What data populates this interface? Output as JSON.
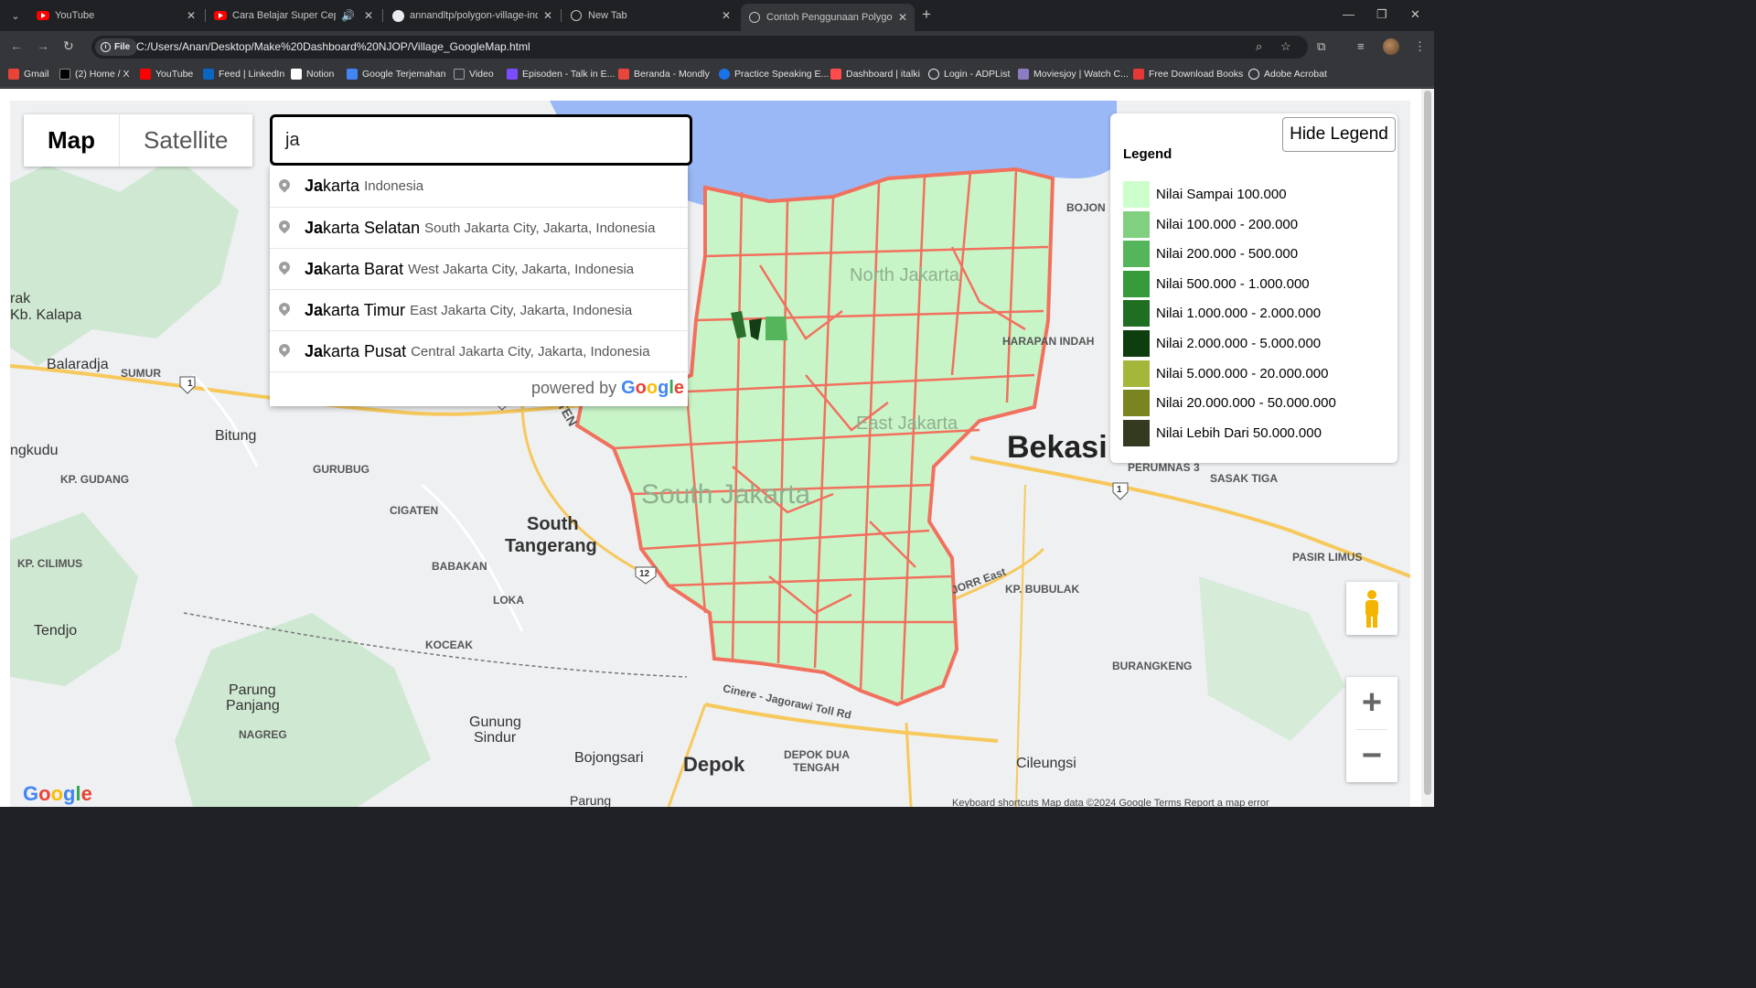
{
  "tabs": [
    {
      "title": "YouTube",
      "icon": "youtube-icon"
    },
    {
      "title": "Cara Belajar Super Cepat pa",
      "icon": "youtube-icon"
    },
    {
      "title": "annandltp/polygon-village-ind",
      "icon": "github-icon"
    },
    {
      "title": "New Tab",
      "icon": "chrome-icon"
    },
    {
      "title": "Contoh Penggunaan Polygon d",
      "icon": "globe-icon"
    }
  ],
  "address": {
    "chip": "File",
    "url": "C:/Users/Anan/Desktop/Make%20Dashboard%20NJOP/Village_GoogleMap.html"
  },
  "bookmarks": [
    {
      "label": "Gmail",
      "color": "#ea4335"
    },
    {
      "label": "(2) Home / X",
      "color": "#000000"
    },
    {
      "label": "YouTube",
      "color": "#ff0000"
    },
    {
      "label": "Feed | LinkedIn",
      "color": "#0a66c2"
    },
    {
      "label": "Notion",
      "color": "#ffffff"
    },
    {
      "label": "Google Terjemahan",
      "color": "#4285f4"
    },
    {
      "label": "Video",
      "color": "#9aa0a6"
    },
    {
      "label": "Episoden - Talk in E...",
      "color": "#7c4dff"
    },
    {
      "label": "Beranda - Mondly",
      "color": "#e8453c"
    },
    {
      "label": "Practice Speaking E...",
      "color": "#1a73e8"
    },
    {
      "label": "Dashboard | italki",
      "color": "#ff4b4b"
    },
    {
      "label": "Login - ADPList",
      "color": "#e8eaed"
    },
    {
      "label": "Moviesjoy | Watch C...",
      "color": "#8e7cc3"
    },
    {
      "label": "Free Download Books",
      "color": "#e53935"
    },
    {
      "label": "Adobe Acrobat",
      "color": "#e8eaed"
    }
  ],
  "map": {
    "map_type_active": "Map",
    "map_type_other": "Satellite",
    "search_value": "ja",
    "suggestions": [
      {
        "bold": "Ja",
        "rest": "karta",
        "secondary": "Indonesia"
      },
      {
        "bold": "Ja",
        "rest": "karta Selatan",
        "secondary": "South Jakarta City, Jakarta, Indonesia"
      },
      {
        "bold": "Ja",
        "rest": "karta Barat",
        "secondary": "West Jakarta City, Jakarta, Indonesia"
      },
      {
        "bold": "Ja",
        "rest": "karta Timur",
        "secondary": "East Jakarta City, Jakarta, Indonesia"
      },
      {
        "bold": "Ja",
        "rest": "karta Pusat",
        "secondary": "Central Jakarta City, Jakarta, Indonesia"
      }
    ],
    "powered_by": "powered by",
    "powered_brand": "Google",
    "hide_legend": "Hide Legend",
    "legend_title": "Legend",
    "legend": [
      {
        "label": "Nilai Sampai 100.000",
        "color": "#ccffcc"
      },
      {
        "label": "Nilai 100.000 - 200.000",
        "color": "#80d080"
      },
      {
        "label": "Nilai 200.000 - 500.000",
        "color": "#55b55a"
      },
      {
        "label": "Nilai 500.000 - 1.000.000",
        "color": "#379a3b"
      },
      {
        "label": "Nilai 1.000.000 - 2.000.000",
        "color": "#1f6e22"
      },
      {
        "label": "Nilai 2.000.000 - 5.000.000",
        "color": "#0e3d0e"
      },
      {
        "label": "Nilai 5.000.000 - 20.000.000",
        "color": "#a5b63a"
      },
      {
        "label": "Nilai 20.000.000 - 50.000.000",
        "color": "#7a8420"
      },
      {
        "label": "Nilai Lebih Dari 50.000.000",
        "color": "#333a20"
      }
    ],
    "labels": {
      "north_jakarta": "North Jakarta",
      "east_jakarta": "East Jakarta",
      "south_jakarta": "South Jakarta",
      "bekasi": "Bekasi",
      "balaradja": "Balaradja",
      "sumur": "SUMUR",
      "bitung": "Bitung",
      "gurubug": "GURUBUG",
      "kp_gudang": "KP. GUDANG",
      "cigaten": "CIGATEN",
      "south_tangerang_1": "South",
      "south_tangerang_2": "Tangerang",
      "babakan": "BABAKAN",
      "loka": "LOKA",
      "kp_cilimus": "KP. CILIMUS",
      "tendjo": "Tendjo",
      "koceak": "KOCEAK",
      "parung_panjang_1": "Parung",
      "parung_panjang_2": "Panjang",
      "nagreg": "NAGREG",
      "gunung_sindur_1": "Gunung",
      "gunung_sindur_2": "Sindur",
      "bojongsari": "Bojongsari",
      "depok": "Depok",
      "depok_dua": "DEPOK DUA",
      "tengah": "TENGAH",
      "cileungsi": "Cileungsi",
      "burangkeng": "BURANGKENG",
      "kp_bubulak": "KP. BUBULAK",
      "pasir_limus": "PASIR LIMUS",
      "perumnas": "PERUMNAS 3",
      "sasak_tiga": "SASAK TIGA",
      "bojon": "BOJON",
      "harapan_indah": "HARAPAN INDAH",
      "kb_kalapa": "Kb. Kalapa",
      "rak": "rak",
      "gkudu": "ngkudu",
      "jorr_east": "JORR East",
      "cinere": "Cinere - Jagorawi Toll Rd",
      "banten": "NTEN",
      "parung": "Parung"
    },
    "route_shields": [
      "1",
      "1",
      "12",
      "1"
    ],
    "attribution": "Keyboard shortcuts    Map data ©2024 Google    Terms    Report a map error"
  }
}
